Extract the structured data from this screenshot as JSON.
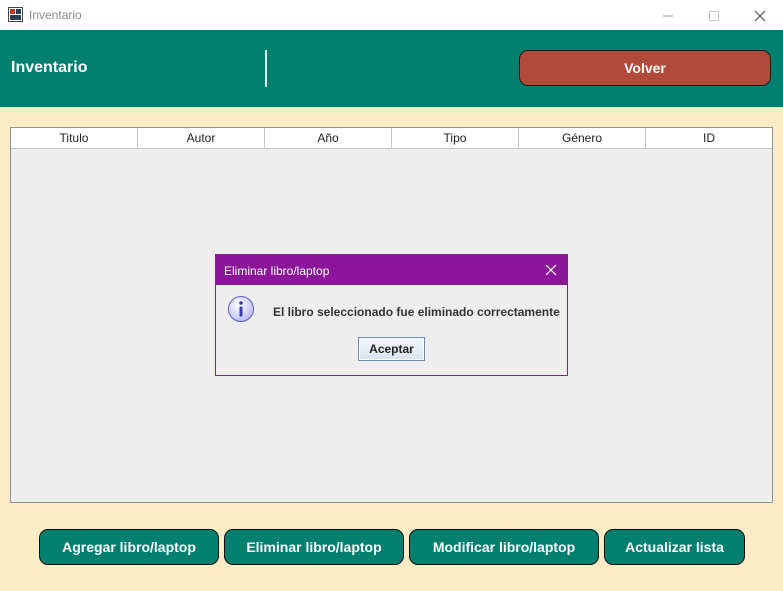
{
  "window": {
    "title": "Inventario"
  },
  "header": {
    "title": "Inventario",
    "back_label": "Volver"
  },
  "table": {
    "columns": [
      "Titulo",
      "Autor",
      "Año",
      "Tipo",
      "Género",
      "ID"
    ],
    "rows": []
  },
  "dialog": {
    "title": "Eliminar libro/laptop",
    "message": "El libro seleccionado fue eliminado correctamente",
    "ok_label": "Aceptar"
  },
  "actions": {
    "add": "Agregar libro/laptop",
    "delete": "Eliminar libro/laptop",
    "modify": "Modificar libro/laptop",
    "refresh": "Actualizar lista"
  },
  "colors": {
    "background": "#fdebc6",
    "primary": "#027f6f",
    "back_button": "#b24a3c",
    "dialog_title": "#8b169a"
  }
}
